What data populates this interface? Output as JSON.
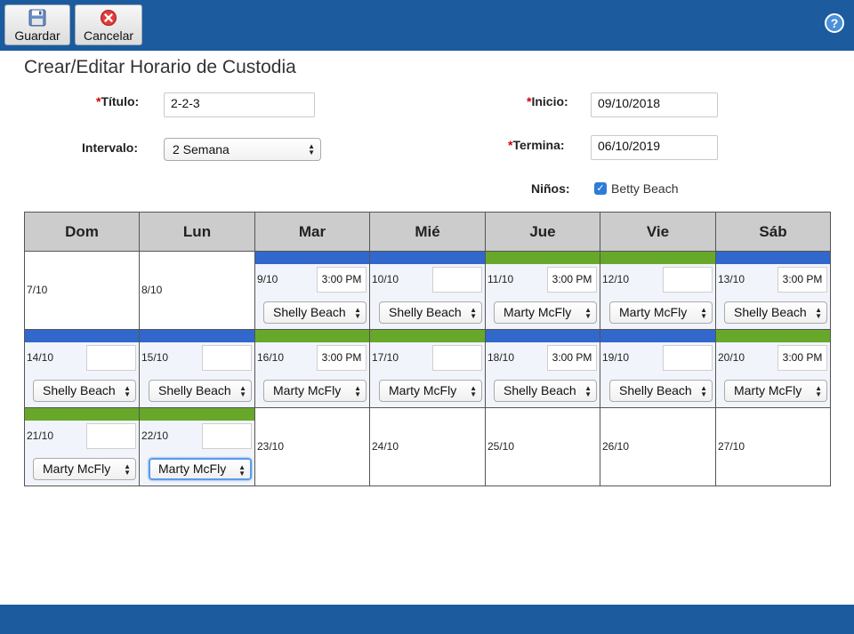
{
  "toolbar": {
    "save_label": "Guardar",
    "cancel_label": "Cancelar",
    "help_glyph": "?"
  },
  "page_title": "Crear/Editar Horario de Custodia",
  "form": {
    "title_label": "Título:",
    "title_value": "2-2-3",
    "interval_label": "Intervalo:",
    "interval_value": "2 Semana",
    "start_label": "Inicio:",
    "start_value": "09/10/2018",
    "end_label": "Termina:",
    "end_value": "06/10/2019",
    "children_label": "Niños:",
    "child_name": "Betty Beach",
    "child_checked": true,
    "required_mark": "*"
  },
  "colors": {
    "toolbar_bg": "#1b5b9e",
    "shelly": "#3267cc",
    "marty": "#67a82a"
  },
  "calendar": {
    "headers": [
      "Dom",
      "Lun",
      "Mar",
      "Mié",
      "Jue",
      "Vie",
      "Sáb"
    ],
    "weeks": [
      [
        {
          "day": "7/10"
        },
        {
          "day": "8/10"
        },
        {
          "day": "9/10",
          "time": "3:00 PM",
          "parent": "Shelly Beach",
          "color": "blue"
        },
        {
          "day": "10/10",
          "time": "",
          "parent": "Shelly Beach",
          "color": "blue"
        },
        {
          "day": "11/10",
          "time": "3:00 PM",
          "parent": "Marty McFly",
          "color": "green"
        },
        {
          "day": "12/10",
          "time": "",
          "parent": "Marty McFly",
          "color": "green"
        },
        {
          "day": "13/10",
          "time": "3:00 PM",
          "parent": "Shelly Beach",
          "color": "blue"
        }
      ],
      [
        {
          "day": "14/10",
          "time": "",
          "parent": "Shelly Beach",
          "color": "blue"
        },
        {
          "day": "15/10",
          "time": "",
          "parent": "Shelly Beach",
          "color": "blue"
        },
        {
          "day": "16/10",
          "time": "3:00 PM",
          "parent": "Marty McFly",
          "color": "green"
        },
        {
          "day": "17/10",
          "time": "",
          "parent": "Marty McFly",
          "color": "green"
        },
        {
          "day": "18/10",
          "time": "3:00 PM",
          "parent": "Shelly Beach",
          "color": "blue"
        },
        {
          "day": "19/10",
          "time": "",
          "parent": "Shelly Beach",
          "color": "blue"
        },
        {
          "day": "20/10",
          "time": "3:00 PM",
          "parent": "Marty McFly",
          "color": "green"
        }
      ],
      [
        {
          "day": "21/10",
          "time": "",
          "parent": "Marty McFly",
          "color": "green"
        },
        {
          "day": "22/10",
          "time": "",
          "parent": "Marty McFly",
          "color": "green",
          "focused": true
        },
        {
          "day": "23/10"
        },
        {
          "day": "24/10"
        },
        {
          "day": "25/10"
        },
        {
          "day": "26/10"
        },
        {
          "day": "27/10"
        }
      ]
    ]
  }
}
